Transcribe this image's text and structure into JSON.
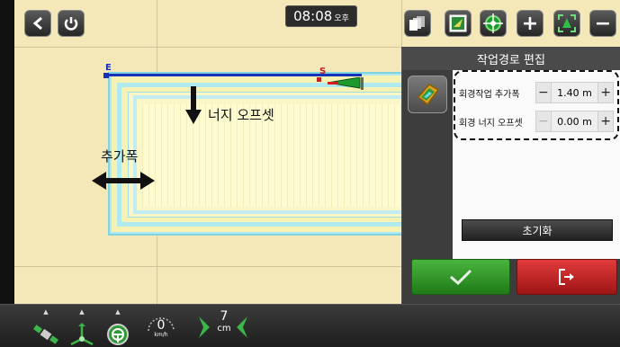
{
  "header": {
    "time": "08:08",
    "ampm": "오후"
  },
  "map": {
    "end_marker": "E",
    "start_marker": "S",
    "label_edge_offset": "너지 오프셋",
    "label_extra_width": "추가폭"
  },
  "panel": {
    "title": "작업경로 편집",
    "settings": [
      {
        "label": "회경작업 추가폭",
        "value": "1.40 m",
        "minus": "−",
        "plus": "+"
      },
      {
        "label": "회경 너지 오프셋",
        "value": "0.00 m",
        "minus": "−",
        "plus": "+"
      }
    ],
    "reset_label": "초기화"
  },
  "status": {
    "speed_value": "0",
    "speed_unit": "km/h",
    "xtrack_value": "7",
    "xtrack_unit": "cm"
  },
  "icons": {
    "back": "chevron-left-icon",
    "power": "power-icon",
    "layers": "layers-icon",
    "map_view": "map-view-icon",
    "gps_target": "gps-target-icon",
    "zoom_in": "plus-icon",
    "fit_view": "fit-view-icon",
    "zoom_out": "minus-icon",
    "confirm": "check-icon",
    "exit": "exit-icon"
  },
  "colors": {
    "path_line": "#1531b8",
    "confirm": "#2f9a27",
    "exit": "#c52222",
    "field_cyan": "#aeeaf0",
    "field_yellow": "#f6f2b4"
  }
}
